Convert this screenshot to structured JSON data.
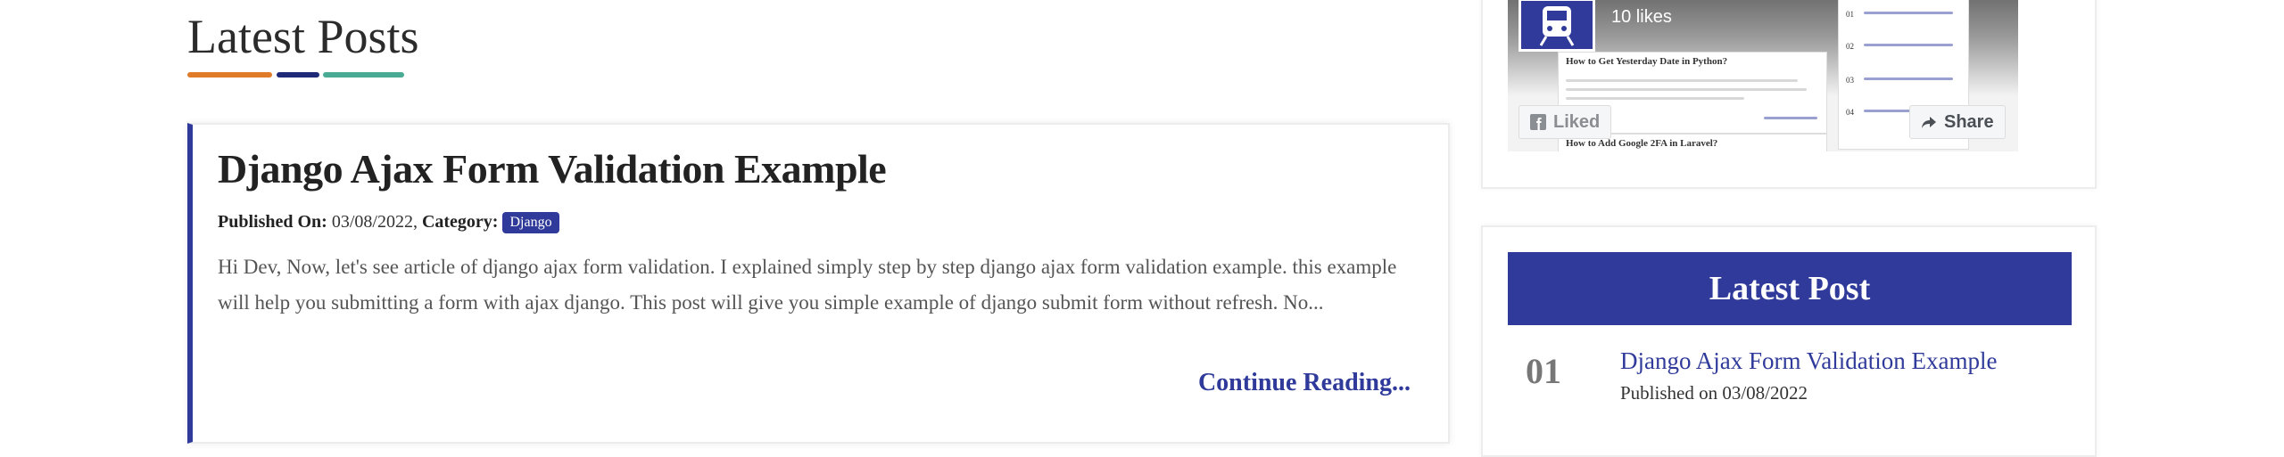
{
  "colors": {
    "primary": "#2f3a9a",
    "bar_orange": "#e07b2a",
    "bar_navy": "#1e2a78",
    "bar_teal": "#4aab95"
  },
  "main": {
    "section_title": "Latest Posts",
    "post": {
      "title": "Django Ajax Form Validation Example",
      "published_label": "Published On:",
      "published_date": "03/08/2022,",
      "category_label": "Category:",
      "category": "Django",
      "excerpt": "Hi Dev, Now, let's see article of django ajax form validation. I explained simply step by step django ajax form validation example. this example will help you submitting a form with ajax django. This post will give you simple example of django submit form without refresh. No...",
      "continue_label": "Continue Reading..."
    }
  },
  "sidebar": {
    "facebook": {
      "likes": "10 likes",
      "liked_label": "Liked",
      "share_label": "Share",
      "preview_post_title": "How to Get Yesterday Date in Python?",
      "preview_post_title_2": "How to Add Google 2FA in Laravel?",
      "preview_list_numbers": [
        "01",
        "02",
        "03",
        "04"
      ]
    },
    "latest": {
      "header": "Latest Post",
      "items": [
        {
          "num": "01",
          "title": "Django Ajax Form Validation Example",
          "date": "Published on 03/08/2022"
        }
      ]
    }
  }
}
